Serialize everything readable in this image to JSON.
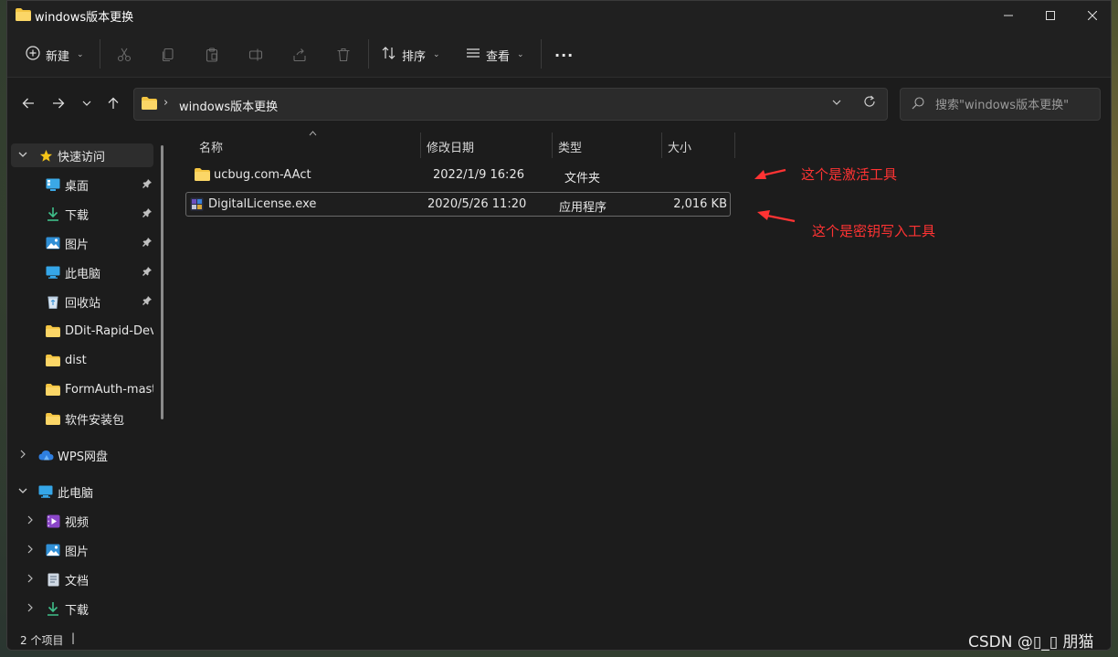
{
  "window": {
    "title": "windows版本更换"
  },
  "toolbar": {
    "new_label": "新建",
    "sort_label": "排序",
    "view_label": "查看",
    "more_label": "···"
  },
  "address": {
    "path": "windows版本更换",
    "separator": "›"
  },
  "search": {
    "placeholder": "搜索\"windows版本更换\""
  },
  "sidebar": {
    "quick_access": "快速访问",
    "pinned": [
      {
        "label": "桌面"
      },
      {
        "label": "下载"
      },
      {
        "label": "图片"
      },
      {
        "label": "此电脑"
      },
      {
        "label": "回收站"
      }
    ],
    "recent": [
      {
        "label": "DDit-Rapid-Develop"
      },
      {
        "label": "dist"
      },
      {
        "label": "FormAuth-master"
      },
      {
        "label": "软件安装包"
      }
    ],
    "wps": "WPS网盘",
    "this_pc": "此电脑",
    "pc_items": [
      {
        "label": "视频"
      },
      {
        "label": "图片"
      },
      {
        "label": "文档"
      },
      {
        "label": "下载"
      }
    ]
  },
  "columns": {
    "name": "名称",
    "date": "修改日期",
    "type": "类型",
    "size": "大小"
  },
  "files": [
    {
      "name": "ucbug.com-AAct",
      "date": "2022/1/9 16:26",
      "type": "文件夹",
      "size": ""
    },
    {
      "name": "DigitalLicense.exe",
      "date": "2020/5/26 11:20",
      "type": "应用程序",
      "size": "2,016 KB"
    }
  ],
  "annotations": {
    "first": "这个是激活工具",
    "second": "这个是密钥写入工具",
    "color": "#ff3333"
  },
  "status": {
    "count": "2 个项目",
    "cursor": "|"
  },
  "watermark": "CSDN @▯_▯ 朋猫"
}
